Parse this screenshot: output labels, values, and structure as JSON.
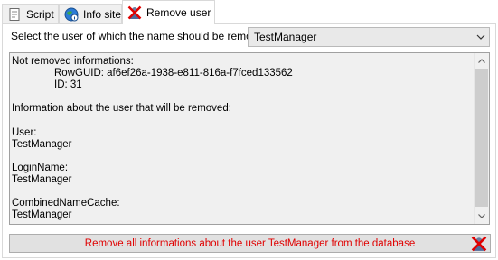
{
  "tabs": [
    {
      "label": "Script",
      "icon": "script-icon"
    },
    {
      "label": "Info site",
      "icon": "globe-info-icon"
    },
    {
      "label": "Remove user",
      "icon": "remove-user-icon"
    }
  ],
  "active_tab": "Remove user",
  "selector": {
    "label": "Select the user of which the name should be removed",
    "value": "TestManager"
  },
  "info": {
    "lines": [
      {
        "text": "Not removed informations:",
        "indent": false
      },
      {
        "text": "RowGUID: af6ef26a-1938-e811-816a-f7fced133562",
        "indent": true
      },
      {
        "text": "ID: 31",
        "indent": true
      },
      {
        "text": "",
        "indent": false
      },
      {
        "text": "Information about the user that will be removed:",
        "indent": false
      },
      {
        "text": "",
        "indent": false
      },
      {
        "text": "User:",
        "indent": false
      },
      {
        "text": "TestManager",
        "indent": false
      },
      {
        "text": "",
        "indent": false
      },
      {
        "text": "LoginName:",
        "indent": false
      },
      {
        "text": "TestManager",
        "indent": false
      },
      {
        "text": "",
        "indent": false
      },
      {
        "text": "CombinedNameCache:",
        "indent": false
      },
      {
        "text": "TestManager",
        "indent": false
      }
    ]
  },
  "remove_button": {
    "label": "Remove all informations about the user TestManager from the database",
    "icon": "remove-user-icon"
  },
  "colors": {
    "danger_text": "#e00000",
    "button_bg": "#e1e1e1",
    "readonly_bg": "#f0f0f0"
  }
}
